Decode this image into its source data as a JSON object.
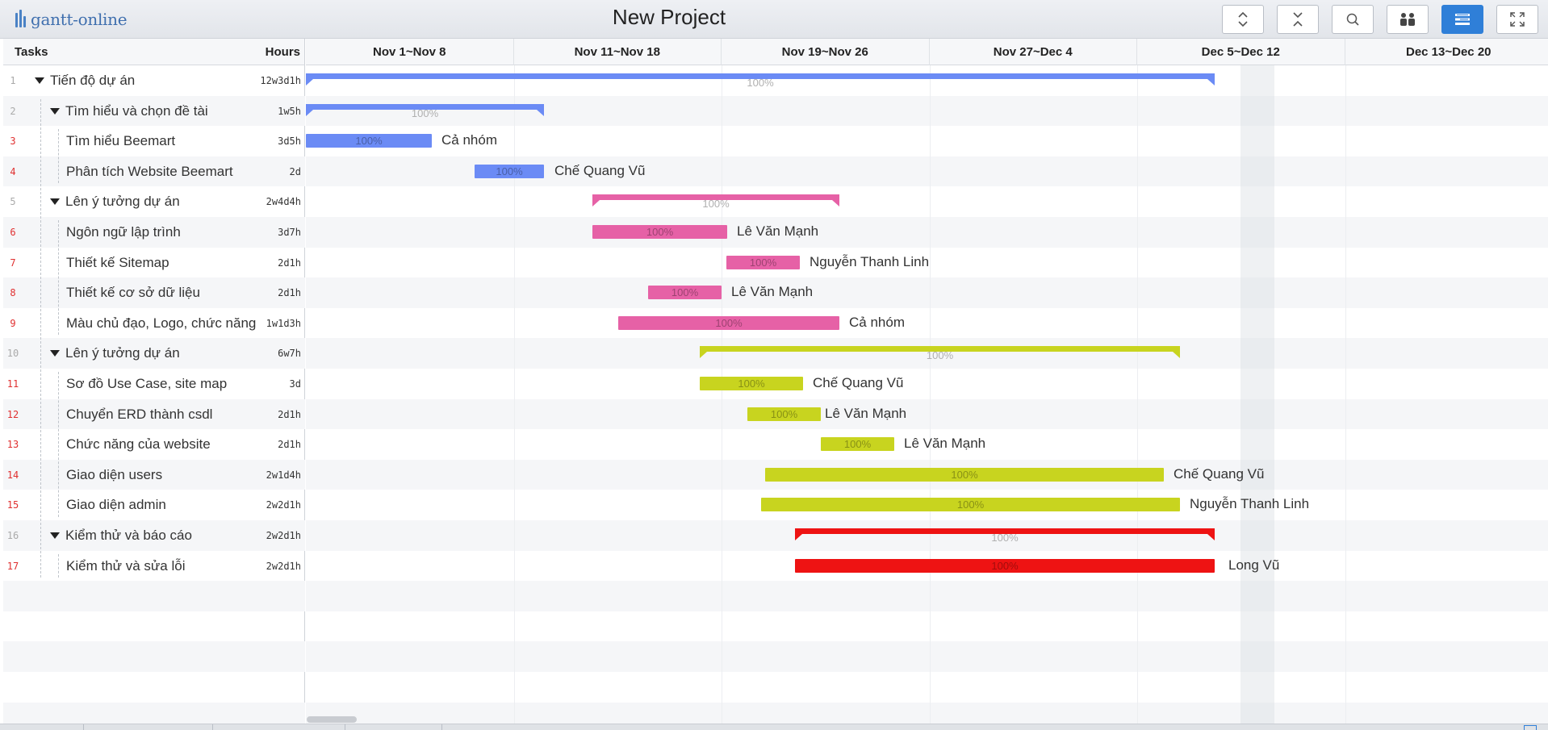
{
  "app": {
    "logo_text": "gantt-online",
    "project_title": "New Project"
  },
  "toolbar": [
    {
      "name": "expand-all-button",
      "icon": "expand-icon"
    },
    {
      "name": "collapse-all-button",
      "icon": "collapse-icon"
    },
    {
      "name": "zoom-button",
      "icon": "search-icon"
    },
    {
      "name": "resources-button",
      "icon": "people-icon"
    },
    {
      "name": "grid-toggle-button",
      "icon": "list-icon",
      "active": true
    },
    {
      "name": "fullscreen-button",
      "icon": "fullscreen-icon"
    }
  ],
  "grid_header": {
    "tasks": "Tasks",
    "hours": "Hours"
  },
  "timeline": {
    "weeks": [
      "Nov 1~Nov 8",
      "Nov 11~Nov 18",
      "Nov 19~Nov 26",
      "Nov 27~Dec 4",
      "Dec 5~Dec 12",
      "Dec 13~Dec 20"
    ]
  },
  "colors": {
    "blue": "#6b8bf5",
    "pink": "#e661a6",
    "lime": "#c8d41f",
    "red": "#ee1313"
  },
  "tasks": [
    {
      "num": "1",
      "name": "Tiến độ dự án",
      "hours": "12w3d1h",
      "level": 0,
      "group": true,
      "color": "blue",
      "progress": "100%",
      "resource": ""
    },
    {
      "num": "2",
      "name": "Tìm hiểu và chọn đề tài",
      "hours": "1w5h",
      "level": 1,
      "group": true,
      "color": "blue",
      "progress": "100%",
      "resource": ""
    },
    {
      "num": "3",
      "name": "Tìm hiểu Beemart",
      "hours": "3d5h",
      "level": 2,
      "group": false,
      "color": "blue",
      "progress": "100%",
      "resource": "Cả nhóm"
    },
    {
      "num": "4",
      "name": "Phân tích Website Beemart",
      "hours": "2d",
      "level": 2,
      "group": false,
      "color": "blue",
      "progress": "100%",
      "resource": "Chế Quang Vũ"
    },
    {
      "num": "5",
      "name": "Lên ý tưởng dự án",
      "hours": "2w4d4h",
      "level": 1,
      "group": true,
      "color": "pink",
      "progress": "100%",
      "resource": ""
    },
    {
      "num": "6",
      "name": "Ngôn ngữ lập trình",
      "hours": "3d7h",
      "level": 2,
      "group": false,
      "color": "pink",
      "progress": "100%",
      "resource": "Lê Văn Mạnh"
    },
    {
      "num": "7",
      "name": "Thiết kế Sitemap",
      "hours": "2d1h",
      "level": 2,
      "group": false,
      "color": "pink",
      "progress": "100%",
      "resource": "Nguyễn Thanh Linh"
    },
    {
      "num": "8",
      "name": "Thiết kế cơ sở dữ liệu",
      "hours": "2d1h",
      "level": 2,
      "group": false,
      "color": "pink",
      "progress": "100%",
      "resource": "Lê Văn Mạnh"
    },
    {
      "num": "9",
      "name": "Màu chủ đạo, Logo, chức năng",
      "hours": "1w1d3h",
      "level": 2,
      "group": false,
      "color": "pink",
      "progress": "100%",
      "resource": "Cả nhóm"
    },
    {
      "num": "10",
      "name": "Lên ý tưởng dự án",
      "hours": "6w7h",
      "level": 1,
      "group": true,
      "color": "lime",
      "progress": "100%",
      "resource": ""
    },
    {
      "num": "11",
      "name": "Sơ đồ Use Case, site map",
      "hours": "3d",
      "level": 2,
      "group": false,
      "color": "lime",
      "progress": "100%",
      "resource": "Chế Quang Vũ"
    },
    {
      "num": "12",
      "name": "Chuyển ERD thành csdl",
      "hours": "2d1h",
      "level": 2,
      "group": false,
      "color": "lime",
      "progress": "100%",
      "resource": "Lê Văn Mạnh"
    },
    {
      "num": "13",
      "name": "Chức năng của website",
      "hours": "2d1h",
      "level": 2,
      "group": false,
      "color": "lime",
      "progress": "100%",
      "resource": "Lê Văn Mạnh"
    },
    {
      "num": "14",
      "name": "Giao diện users",
      "hours": "2w1d4h",
      "level": 2,
      "group": false,
      "color": "lime",
      "progress": "100%",
      "resource": "Chế Quang Vũ"
    },
    {
      "num": "15",
      "name": "Giao diện admin",
      "hours": "2w2d1h",
      "level": 2,
      "group": false,
      "color": "lime",
      "progress": "100%",
      "resource": "Nguyễn Thanh Linh"
    },
    {
      "num": "16",
      "name": "Kiểm thử và báo cáo",
      "hours": "2w2d1h",
      "level": 1,
      "group": true,
      "color": "red",
      "progress": "100%",
      "resource": ""
    },
    {
      "num": "17",
      "name": "Kiểm thử và sửa lỗi",
      "hours": "2w2d1h",
      "level": 2,
      "group": false,
      "color": "red",
      "progress": "100%",
      "resource": "Long Vũ"
    }
  ]
}
